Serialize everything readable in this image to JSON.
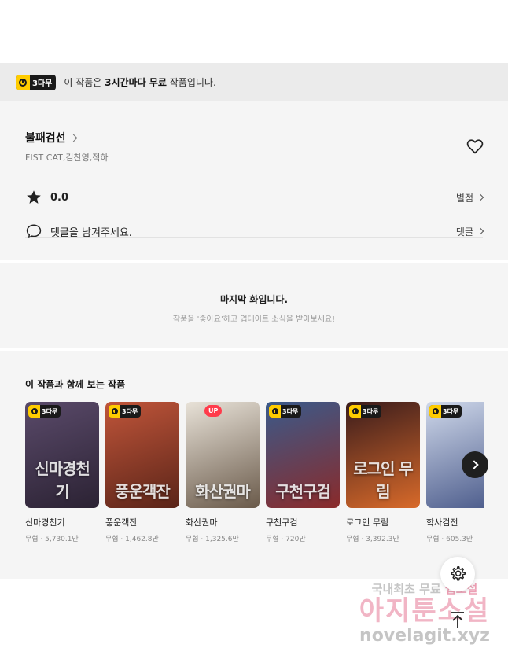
{
  "banner": {
    "badge": "3다무",
    "text_pre": "이 작품은 ",
    "text_bold": "3시간마다 무료",
    "text_post": " 작품입니다."
  },
  "work": {
    "title": "불패검선",
    "authors": "FIST CAT,김찬영,적하",
    "rating": "0.0",
    "rating_action": "별점",
    "comment_prompt": "댓글을 남겨주세요.",
    "comment_action": "댓글"
  },
  "last_episode": {
    "heading": "마지막 화입니다.",
    "sub": "작품을 '좋아요'하고 업데이트 소식을 받아보세요!"
  },
  "recommend": {
    "heading": "이 작품과 함께 보는 작품",
    "items": [
      {
        "name": "신마경천기",
        "meta": "무협 · 5,730.1만",
        "badge": "3다무",
        "cover": "신마경천기",
        "colors": [
          "#5a4a6a",
          "#2b2233"
        ]
      },
      {
        "name": "풍운객잔",
        "meta": "무협 · 1,462.8만",
        "badge": "3다무",
        "cover": "풍운객잔",
        "colors": [
          "#c0553a",
          "#5a2418"
        ]
      },
      {
        "name": "화산권마",
        "meta": "무협 · 1,325.6만",
        "badge": "UP",
        "cover": "화산권마",
        "colors": [
          "#e8e2d8",
          "#6a5a4a"
        ]
      },
      {
        "name": "구천구검",
        "meta": "무협 · 720만",
        "badge": "3다무",
        "cover": "구천구검",
        "colors": [
          "#3a5a8a",
          "#8a2a2a"
        ]
      },
      {
        "name": "로그인 무림",
        "meta": "무협 · 3,392.3만",
        "badge": "3다무",
        "cover": "로그인 무림",
        "colors": [
          "#3a1c1c",
          "#d86a2a"
        ]
      },
      {
        "name": "학사검전",
        "meta": "무협 · 605.3만",
        "badge": "3다무",
        "cover": "",
        "colors": [
          "#cfd8ea",
          "#4a5a8a"
        ]
      }
    ]
  },
  "watermark": {
    "line1_pre": "국내최초 무료",
    "line1_post": "웹소설",
    "line2": "아지툰소설",
    "line3": "novelagit.xyz"
  },
  "icons": {
    "clock": "clock-icon",
    "heart": "heart-icon",
    "star": "star-icon",
    "comment": "speech-bubble-icon",
    "next": "chevron-right-icon",
    "settings": "gear-icon",
    "top": "arrow-up-icon"
  }
}
